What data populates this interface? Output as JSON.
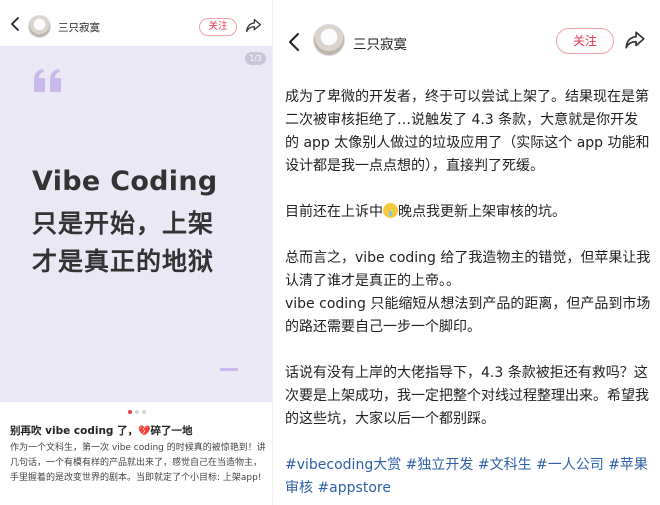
{
  "left": {
    "author": "三只寂寞",
    "follow_label": "关注",
    "page_indicator": "1/3",
    "hero": {
      "line1_highlight": "Vibe",
      "line1_rest": " Coding",
      "line2": "只是开始，上架",
      "line3": "才是真正的地狱"
    },
    "carousel": {
      "total": 3,
      "active_index": 0
    },
    "post_title_before": "别再吹 vibe coding 了，",
    "post_title_after": "碎了一地",
    "post_body": "作为一个文科生，第一次 vibe coding 的时候真的被惊艳到！讲几句话，一个有模有样的产品就出来了，感觉自己在当造物主，手里握着的是改变世界的剧本。当即就定了个小目标: 上架app!"
  },
  "right": {
    "author": "三只寂寞",
    "follow_label": "关注",
    "para1": "成为了卑微的开发者，终于可以尝试上架了。结果现在是第二次被审核拒绝了…说触发了 4.3 条款，大意就是你开发的 app 太像别人做过的垃圾应用了（实际这个 app 功能和设计都是我一点点想的），直接判了死缓。",
    "para2_before": "目前还在上诉中",
    "para2_after": "晚点我更新上架审核的坑。",
    "para3a": "总而言之，vibe coding 给了我造物主的错觉，但苹果让我认清了谁才是真正的上帝。。",
    "para3b": "vibe coding 只能缩短从想法到产品的距离，但产品到市场的路还需要自己一步一个脚印。",
    "para4": "话说有没有上岸的大佬指导下，4.3 条款被拒还有救吗？这次要是上架成功，我一定把整个对线过程整理出来。希望我的这些坑，大家以后一个都别踩。",
    "tags": "#vibecoding大赏 #独立开发 #文科生 #一人公司 #苹果审核 #appstore"
  },
  "colors": {
    "accent_red": "#e8344a",
    "hero_bg": "#ebe8f5",
    "highlight_yellow": "#f7bd3c",
    "tag_blue": "#2d5fa8"
  },
  "icons": [
    "back-arrow-icon",
    "share-icon",
    "quote-icon",
    "avatar",
    "crying-face-icon",
    "broken-heart-icon"
  ]
}
